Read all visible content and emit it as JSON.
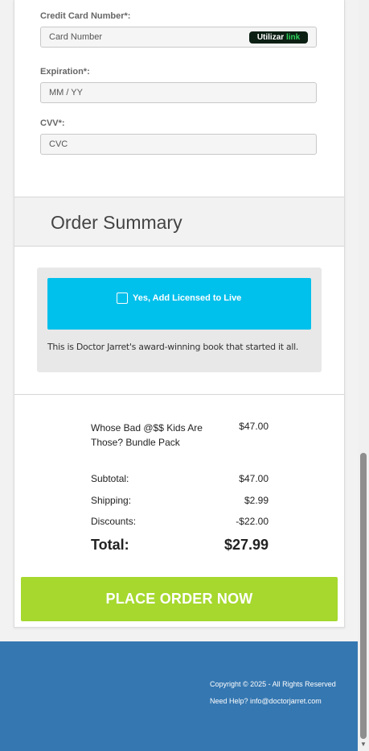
{
  "payment": {
    "card_number_label": "Credit Card Number*:",
    "card_number_placeholder": "Card Number",
    "link_prefix": "Utilizar",
    "link_accent": "link",
    "expiration_label": "Expiration*:",
    "expiration_placeholder": "MM / YY",
    "cvv_label": "CVV*:",
    "cvv_placeholder": "CVC"
  },
  "summary": {
    "title": "Order Summary",
    "offer_label": "Yes, Add Licensed to Live",
    "offer_description": "This is Doctor Jarret's award-winning book that started it all.",
    "product_name": "Whose Bad @$$ Kids Are Those? Bundle Pack",
    "product_price": "$47.00",
    "subtotal_label": "Subtotal:",
    "subtotal_value": "$47.00",
    "shipping_label": "Shipping:",
    "shipping_value": "$2.99",
    "discounts_label": "Discounts:",
    "discounts_value": "-$22.00",
    "total_label": "Total:",
    "total_value": "$27.99",
    "place_order_label": "PLACE ORDER NOW"
  },
  "footer": {
    "copyright": "Copyright © 2025 - All Rights Reserved",
    "help": "Need Help? info@doctorjarret.com"
  },
  "colors": {
    "offer_button": "#00c0ec",
    "place_order_button": "#a6d82e",
    "footer_background": "#3577b1",
    "link_button": "#0b1f13",
    "link_accent": "#2fd35c"
  },
  "icons": {
    "checkbox": "checkbox-icon",
    "scroll_down": "scroll-down-arrow-icon"
  }
}
